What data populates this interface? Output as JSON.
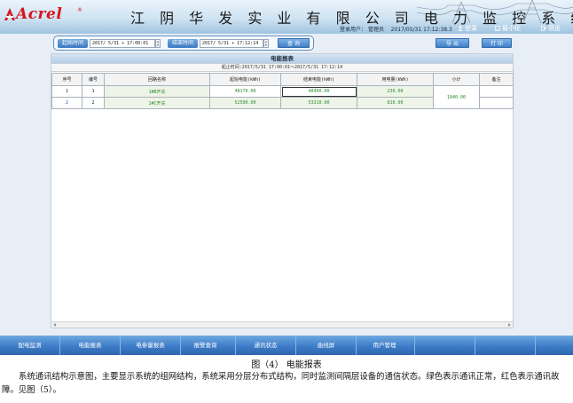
{
  "header": {
    "logo_text": "Acrel",
    "logo_reg": "®",
    "system_title": "江 阴 华 发 实 业 有 限 公 司 电 力 监 控 系 统",
    "user_label": "登录用户：",
    "user_name": "管理员",
    "datetime": "2017/05/31  17:12:38.3",
    "login_label": "登录",
    "minimize_label": "最小化",
    "exit_label": "退出",
    "colors": {
      "brand": "#d9151b",
      "accent": "#3d7cc8"
    }
  },
  "toolbar": {
    "start_label": "起始时间",
    "start_value": "2017/ 5/31   ▾ 17:00:01",
    "end_label": "结束时间",
    "end_value": "2017/ 5/31   ▾ 17:12:14",
    "query_label": "查 询",
    "export_label": "导 出",
    "print_label": "打 印"
  },
  "report": {
    "title": "电能报表",
    "range": "起止时间:2017/5/31 17:00:01～2017/5/31 17:12:14",
    "columns": [
      "序号",
      "编号",
      "回路名称",
      "起始电能(kWh)",
      "结束电能(kWh)",
      "用电量(kWh)",
      "小计",
      "备注"
    ],
    "rows": [
      {
        "seq": "1",
        "code": "1",
        "name": "1#B开关",
        "start": "48170.00",
        "end": "48400.00",
        "usage": "230.00"
      },
      {
        "seq": "2",
        "code": "2",
        "name": "1#C开关",
        "start": "52500.00",
        "end": "53310.00",
        "usage": "810.00"
      }
    ],
    "subtotal": "1040.00",
    "remark": ""
  },
  "nav": {
    "items": [
      "配电监测",
      "电能报表",
      "电参量报表",
      "报警查询",
      "通讯状态",
      "曲线屏",
      "用户管理",
      "",
      "",
      ""
    ]
  },
  "caption": "图（4）  电能报表",
  "paragraph": "系统通讯结构示意图，主要显示系统的组网结构，系统采用分层分布式结构，同时监测间隔层设备的通信状态。绿色表示通讯正常，红色表示通讯故障。见图（5）。"
}
